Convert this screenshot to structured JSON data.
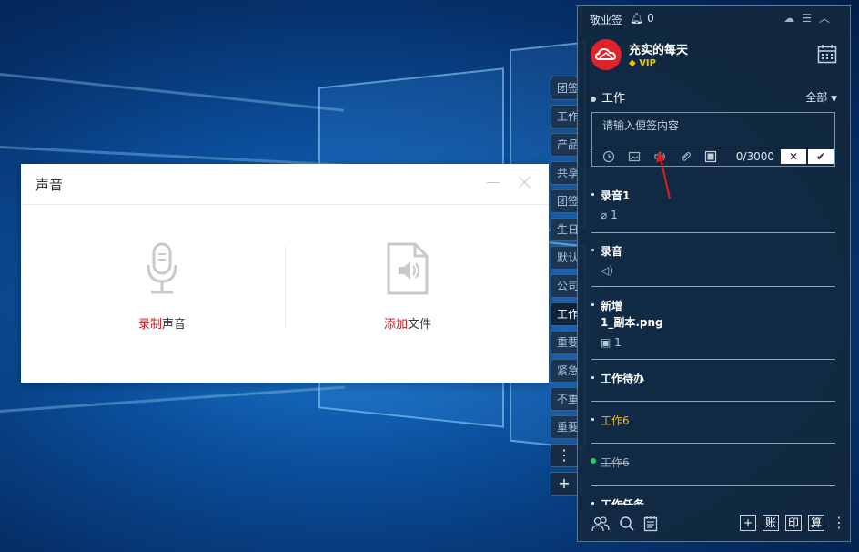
{
  "dialog": {
    "title": "声音",
    "record": {
      "highlight": "录制",
      "rest": "声音"
    },
    "add": {
      "highlight": "添加",
      "rest": "文件"
    }
  },
  "categories": [
    "团签",
    "工作",
    "产品",
    "共享",
    "团签",
    "生日",
    "默认",
    "公司",
    "工作",
    "重要",
    "紧急",
    "不重",
    "重要"
  ],
  "side_buttons": {
    "more": "⋮",
    "add": "+"
  },
  "panel": {
    "app_name": "敬业签",
    "notif_count": "0",
    "user_name": "充实的每天",
    "vip_label": "VIP",
    "category_title": "工作",
    "filter_label": "全部",
    "editor_placeholder": "请输入便签内容",
    "counter": "0/3000",
    "cancel": "✕",
    "ok": "✔",
    "notes": [
      {
        "title": "录音1",
        "meta": "1"
      },
      {
        "title": "录音"
      },
      {
        "title": "新增",
        "line2": "1_副本.png",
        "meta": "1"
      },
      {
        "title": "工作待办"
      },
      {
        "title": "工作6"
      },
      {
        "title": "工作6"
      },
      {
        "title": "工作任务"
      }
    ],
    "bottom_boxes": [
      "+",
      "账",
      "印",
      "算"
    ],
    "bottom_more": "⋮"
  },
  "colors": {
    "accent_red": "#c8161d",
    "panel_bg": "#12283e",
    "gold": "#f0b42a",
    "done_green": "#28c86b"
  }
}
